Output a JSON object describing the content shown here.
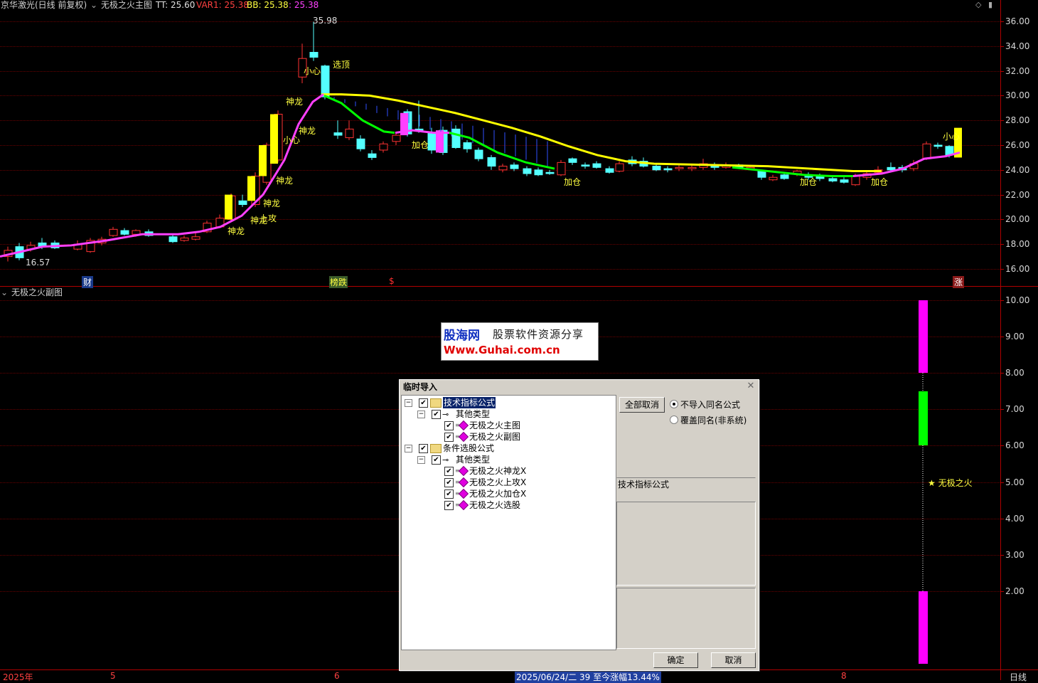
{
  "header": {
    "stock": "京华激光(日线 前复权)",
    "indicator": "无极之火主图",
    "tt_label": "TT: 25.60",
    "var1_label": "VAR1: 25.38",
    "bb_label": "BB: 25.38",
    "extra_label": ": 25.38"
  },
  "sub_header": {
    "indicator": "无极之火副图"
  },
  "main_axis": {
    "ticks": [
      "36.00",
      "34.00",
      "32.00",
      "30.00",
      "28.00",
      "26.00",
      "24.00",
      "22.00",
      "20.00",
      "18.00",
      "16.00"
    ]
  },
  "sub_axis": {
    "ticks": [
      "10.00",
      "9.00",
      "8.00",
      "7.00",
      "6.00",
      "5.00",
      "4.00",
      "3.00",
      "2.00"
    ]
  },
  "price_marks": {
    "high": "35.98",
    "low": "16.57"
  },
  "signals": {
    "shenlong": "神龙",
    "xiaoxin": "小心",
    "xuanding": "选顶",
    "shanggong": "上攻",
    "jiacang": "加仓"
  },
  "bottom_markers": {
    "cai": "财",
    "bangdie": "榜跌",
    "dollar": "$",
    "zhang": "涨"
  },
  "watermark": {
    "line1": "股海网",
    "line1b": "股票软件资源分享",
    "line2": "Www.Guhai.com.cn"
  },
  "sub_legend": "★ 无极之火",
  "timeline": {
    "year": "2025年",
    "m5": "5",
    "m6": "6",
    "m8": "8",
    "status": "2025/06/24/二 39 至今涨幅13.44%",
    "period": "日线"
  },
  "dialog": {
    "title": "临时导入",
    "tree": {
      "root1": "技术指标公式",
      "root1_child": "其他类型",
      "root1_items": [
        "无极之火主图",
        "无极之火副图"
      ],
      "root2": "条件选股公式",
      "root2_child": "其他类型",
      "root2_items": [
        "无极之火神龙X",
        "无极之火上攻X",
        "无极之火加仓X",
        "无极之火选股"
      ]
    },
    "cancel_all": "全部取消",
    "radio_skip": "不导入同名公式",
    "radio_overwrite": "覆盖同名(非系统)",
    "info_label": "技术指标公式",
    "ok": "确定",
    "cancel": "取消"
  },
  "colors": {
    "up": "#ff3232",
    "down": "#54ffff",
    "ma_magenta": "#ff40ff",
    "ma_yellow": "#ffff00",
    "ma_green": "#00ff00",
    "grid": "#6a0000"
  }
}
